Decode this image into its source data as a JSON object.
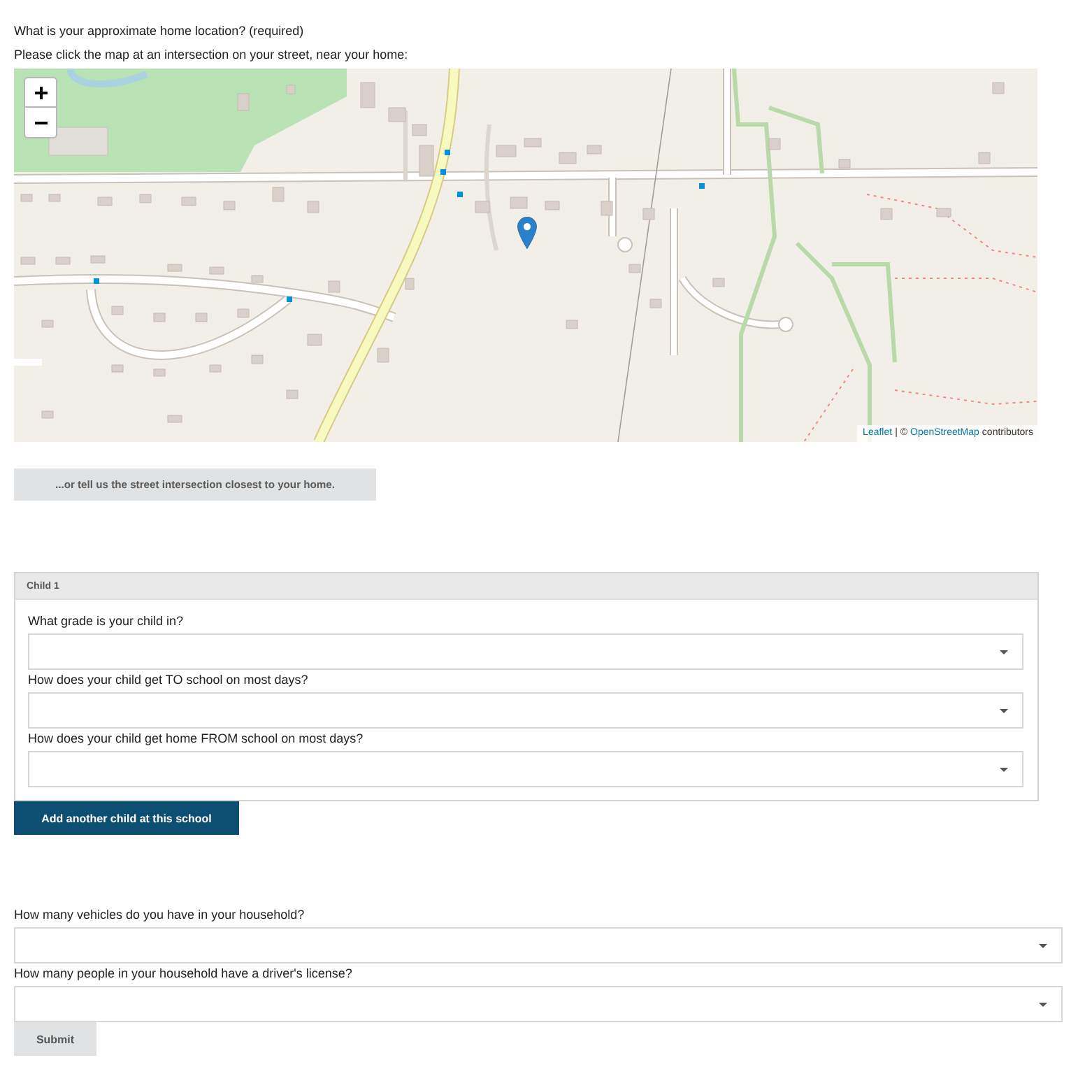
{
  "location_question": {
    "title": "What is your approximate home location? (required)",
    "instruction": "Please click the map at an intersection on your street, near your home:"
  },
  "map": {
    "attribution": [
      {
        "kind": "link",
        "text": "Leaflet"
      },
      {
        "kind": "text",
        "text": "| ©"
      },
      {
        "kind": "link",
        "text": "OpenStreetMap"
      },
      {
        "kind": "text",
        "text": "contributors"
      }
    ]
  },
  "intersection_button": "...or tell us the street intersection closest to your home.",
  "child_panel": {
    "title": "Child 1",
    "fields": [
      {
        "label": "What grade is your child in?"
      },
      {
        "label": "How does your child get TO school on most days?"
      },
      {
        "label": "How does your child get home FROM school on most days?"
      }
    ]
  },
  "add_child_button": "Add another child at this school",
  "household_fields": [
    {
      "label": "How many vehicles do you have in your household?"
    },
    {
      "label": "How many people in your household have a driver's license?"
    }
  ],
  "submit_button": "Submit"
}
